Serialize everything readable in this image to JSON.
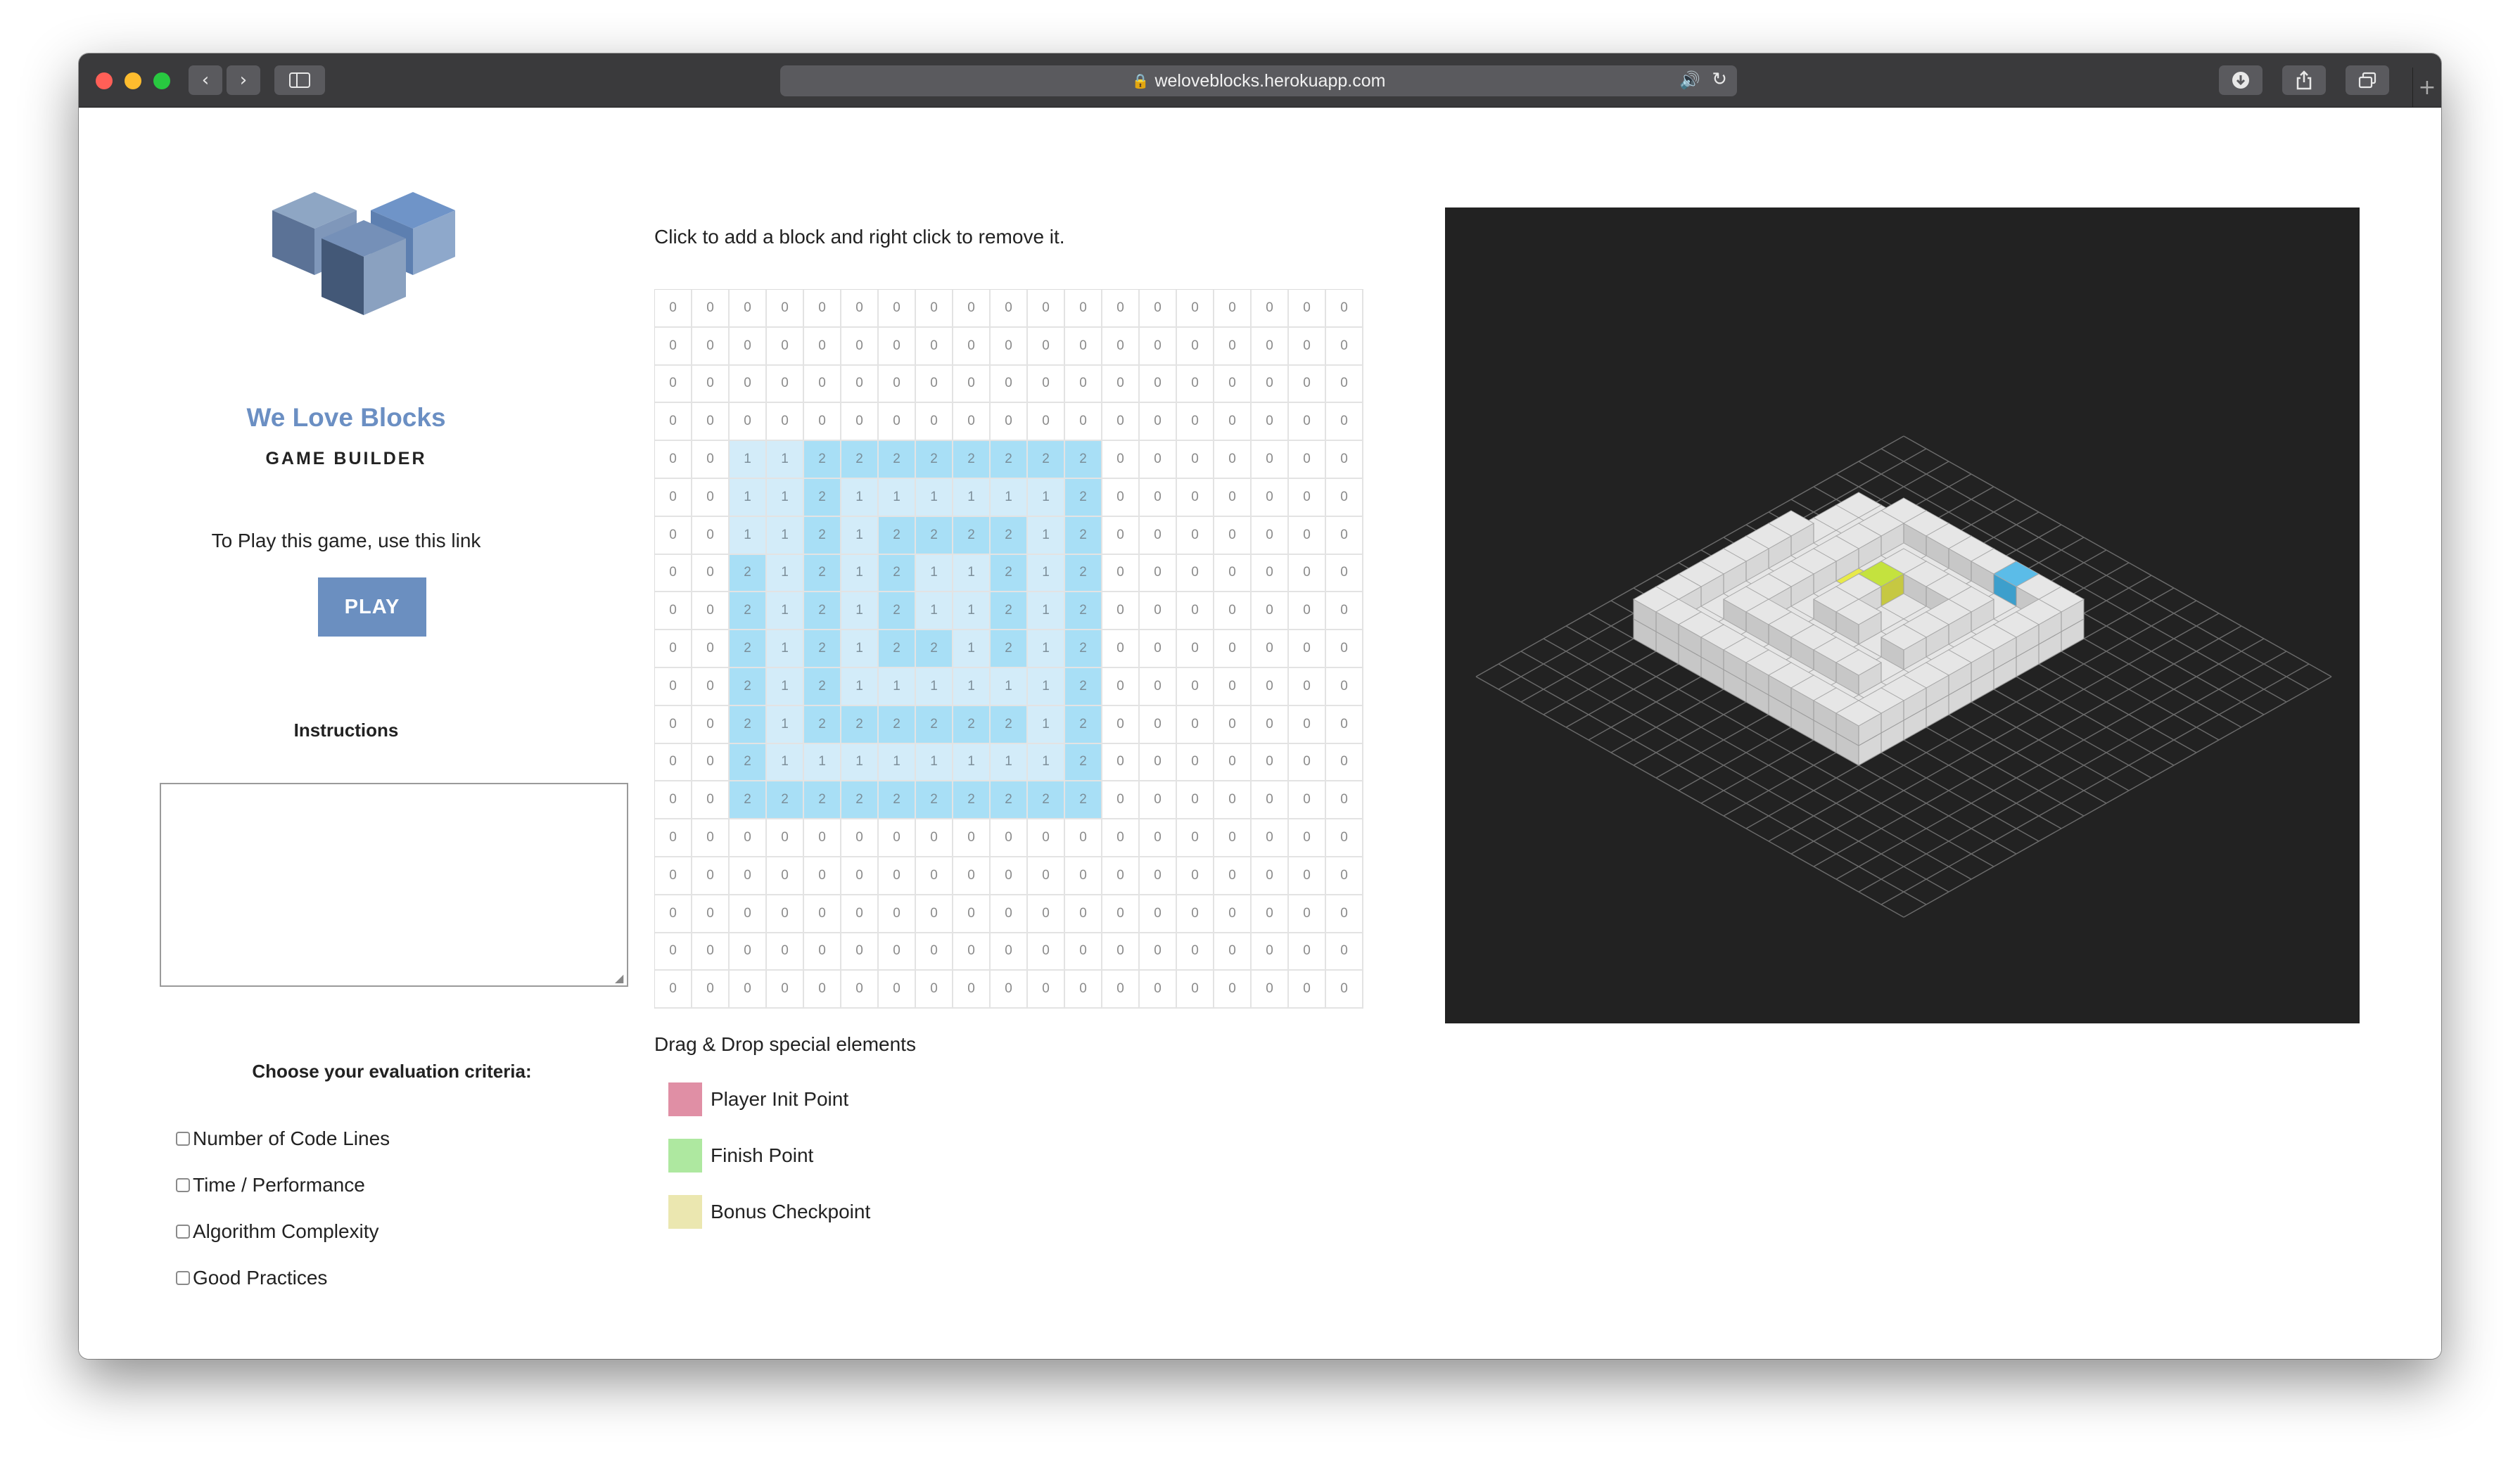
{
  "browser": {
    "url": "weloveblocks.herokuapp.com",
    "icons": {
      "back": "chevron-left-icon",
      "forward": "chevron-right-icon",
      "sidebar": "sidebar-icon",
      "lock": "lock-icon",
      "audio": "speaker-icon",
      "reload": "reload-icon",
      "download": "download-icon",
      "share": "share-icon",
      "tabs": "tabs-overview-icon",
      "new_tab": "plus-icon"
    }
  },
  "brand": {
    "name": "We Love Blocks",
    "subtitle": "GAME BUILDER",
    "color": "#6b8fc3"
  },
  "play": {
    "text": "To Play this game, use this link",
    "button_label": "PLAY"
  },
  "instructions": {
    "title": "Instructions",
    "value": ""
  },
  "criteria": {
    "title": "Choose your evaluation criteria:",
    "items": [
      {
        "label": "Number of Code Lines",
        "checked": false
      },
      {
        "label": "Time / Performance",
        "checked": false
      },
      {
        "label": "Algorithm Complexity",
        "checked": false
      },
      {
        "label": "Good Practices",
        "checked": false
      }
    ]
  },
  "editor": {
    "hint": "Click to add a block and right click to remove it.",
    "grid": [
      "0000000000000000000",
      "0000000000000000000",
      "0000000000000000000",
      "0000000000000000000",
      "0011222222220000000",
      "0011211111120000000",
      "0011212222120000000",
      "0021212112120000000",
      "0021212112120000000",
      "0021212212120000000",
      "0021211111120000000",
      "0021222222120000000",
      "0021111111120000000",
      "0022222222220000000",
      "0000000000000000000",
      "0000000000000000000",
      "0000000000000000000",
      "0000000000000000000",
      "0000000000000000000"
    ]
  },
  "special": {
    "title": "Drag & Drop special elements",
    "items": [
      {
        "label": "Player Init Point",
        "color": "#e08fa5"
      },
      {
        "label": "Finish Point",
        "color": "#aee8a0"
      },
      {
        "label": "Bonus Checkpoint",
        "color": "#ebe7b0"
      }
    ]
  },
  "viewport": {
    "background": "#222222",
    "block_color": "#e6e6e6",
    "highlight_blue": "#5bbce8",
    "highlight_yellow": "#e8ea4a",
    "highlight_lime": "#c4e23e"
  }
}
